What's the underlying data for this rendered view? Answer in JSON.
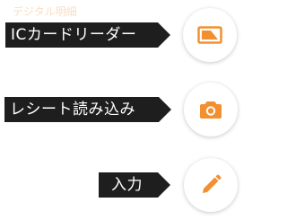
{
  "header": {
    "faint_text": "デジタル明細"
  },
  "options": {
    "ic_card_reader": {
      "label": "ICカードリーダー",
      "icon": "card-icon"
    },
    "receipt_scan": {
      "label": "レシート読み込み",
      "icon": "camera-icon"
    },
    "manual_input": {
      "label": "入力",
      "icon": "pencil-icon"
    }
  },
  "colors": {
    "accent": "#f29031",
    "label_background": "#1e1e1e",
    "label_text": "#ffffff",
    "circle_background": "#ffffff"
  }
}
